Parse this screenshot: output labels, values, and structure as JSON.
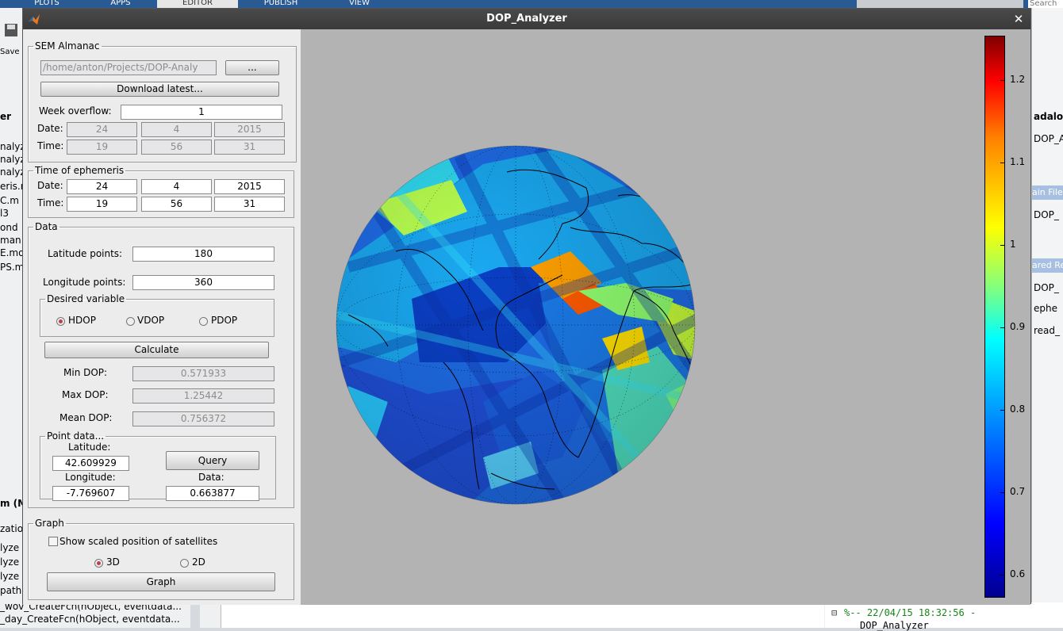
{
  "background_desktop": {
    "toolstrip_tabs": [
      "PLOTS",
      "APPS",
      "EDITOR",
      "PUBLISH",
      "VIEW"
    ],
    "search_placeholder": "Search",
    "save_label": "Save",
    "left_partial_texts": [
      "er",
      "nalyz",
      "nalyz",
      "nalyz",
      "eris.r",
      "C.m",
      "l3",
      "ond",
      "man",
      "E.mo",
      "PS.m",
      "m (M",
      "zatio",
      "lyze",
      "lyze",
      "lyze",
      "path",
      "_wov_CreateFcn(hObject, eventdata...",
      "_day_CreateFcn(hObject, eventdata..."
    ],
    "right_partial_texts": [
      "adalon",
      "DOP_A",
      "ain File",
      "DOP_",
      "ared Re",
      "DOP_",
      "ephe",
      "read_"
    ],
    "command_history": "%-- 22/04/15 18:32:56 -",
    "command_history_next": "DOP_Analyzer"
  },
  "window": {
    "title": "DOP_Analyzer",
    "close_symbol": "✕"
  },
  "sem_almanac": {
    "legend": "SEM Almanac",
    "path_value": "/home/anton/Projects/DOP-Analy",
    "browse_label": "...",
    "download_label": "Download latest...",
    "week_overflow_label": "Week overflow:",
    "week_overflow_value": "1",
    "date_label": "Date:",
    "date_day": "24",
    "date_month": "4",
    "date_year": "2015",
    "time_label": "Time:",
    "time_hour": "19",
    "time_min": "56",
    "time_sec": "31"
  },
  "ephemeris": {
    "legend": "Time of ephemeris",
    "date_label": "Date:",
    "date_day": "24",
    "date_month": "4",
    "date_year": "2015",
    "time_label": "Time:",
    "time_hour": "19",
    "time_min": "56",
    "time_sec": "31"
  },
  "data_panel": {
    "legend": "Data",
    "lat_points_label": "Latitude points:",
    "lat_points_value": "180",
    "lon_points_label": "Longitude points:",
    "lon_points_value": "360",
    "desired_variable_legend": "Desired variable",
    "options": [
      "HDOP",
      "VDOP",
      "PDOP"
    ],
    "selected_option": "HDOP",
    "calculate_label": "Calculate",
    "min_label": "Min DOP:",
    "min_value": "0.571933",
    "max_label": "Max DOP:",
    "max_value": "1.25442",
    "mean_label": "Mean DOP:",
    "mean_value": "0.756372",
    "point_legend": "Point data...",
    "latitude_label": "Latitude:",
    "latitude_value": "42.609929",
    "longitude_label": "Longitude:",
    "longitude_value": "-7.769607",
    "query_label": "Query",
    "data_label": "Data:",
    "data_value": "0.663877"
  },
  "graph_panel": {
    "legend": "Graph",
    "show_satellites_label": "Show scaled position of satellites",
    "show_satellites_checked": false,
    "mode_options": [
      "3D",
      "2D"
    ],
    "selected_mode": "3D",
    "graph_label": "Graph"
  },
  "colorbar": {
    "tick_labels": [
      "1.2",
      "1.1",
      "1",
      "0.9",
      "0.8",
      "0.7",
      "0.6"
    ],
    "colormap": "jet",
    "range": [
      0.571933,
      1.25442
    ]
  },
  "colors": {
    "titlebar": "#3a3a3a",
    "figure_background": "#b3b3b3",
    "panel_background": "#ececec",
    "toolstrip": "#2a5a93"
  }
}
